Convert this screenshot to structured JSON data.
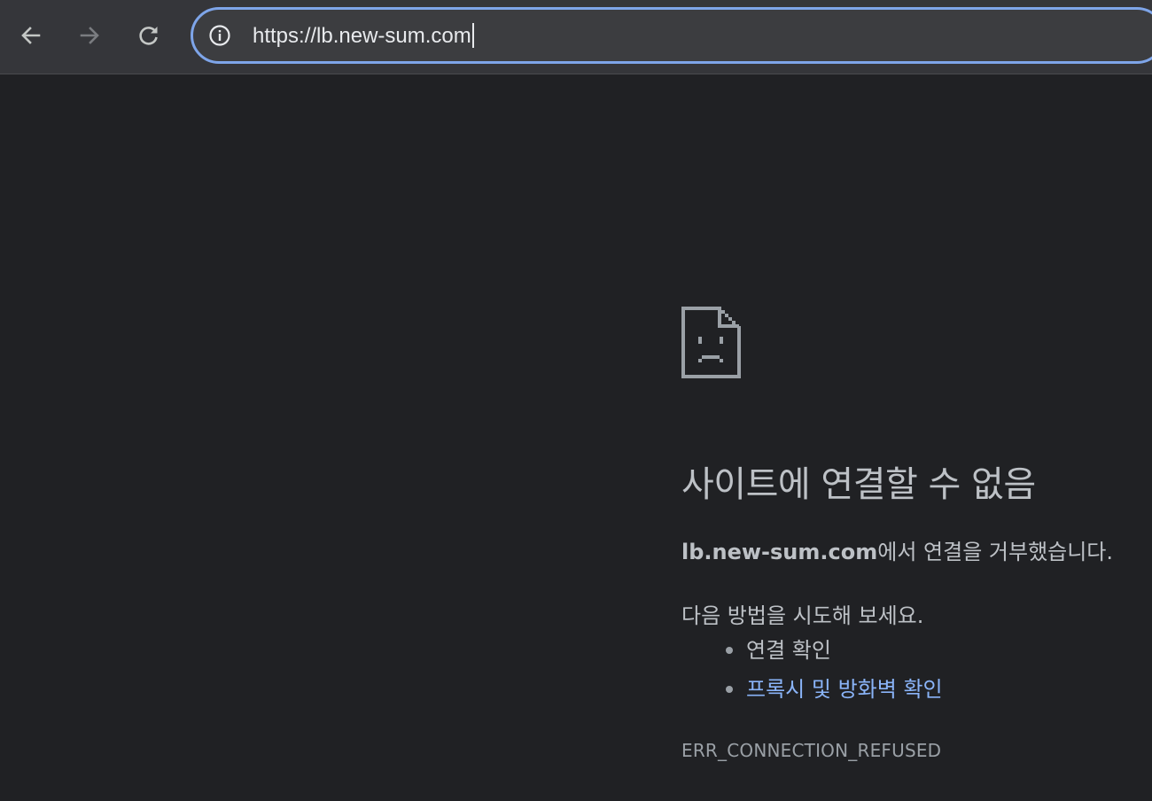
{
  "toolbar": {
    "back_icon": "arrow-left-icon",
    "forward_icon": "arrow-right-icon",
    "reload_icon": "reload-icon",
    "info_icon": "info-circle-icon"
  },
  "omnibox": {
    "url": "https://lb.new-sum.com"
  },
  "error": {
    "icon": "sad-document-icon",
    "title": "사이트에 연결할 수 없음",
    "host": "lb.new-sum.com",
    "desc_suffix": "에서 연결을 거부했습니다.",
    "try_title": "다음 방법을 시도해 보세요.",
    "suggestions": [
      {
        "label": "연결 확인",
        "is_link": false
      },
      {
        "label": "프록시 및 방화벽 확인",
        "is_link": true
      }
    ],
    "code": "ERR_CONNECTION_REFUSED"
  },
  "colors": {
    "background": "#202124",
    "toolbar": "#35363a",
    "omnibox_border": "#7ea5e9",
    "text": "#bdc1c6",
    "link": "#8ab4f8"
  }
}
